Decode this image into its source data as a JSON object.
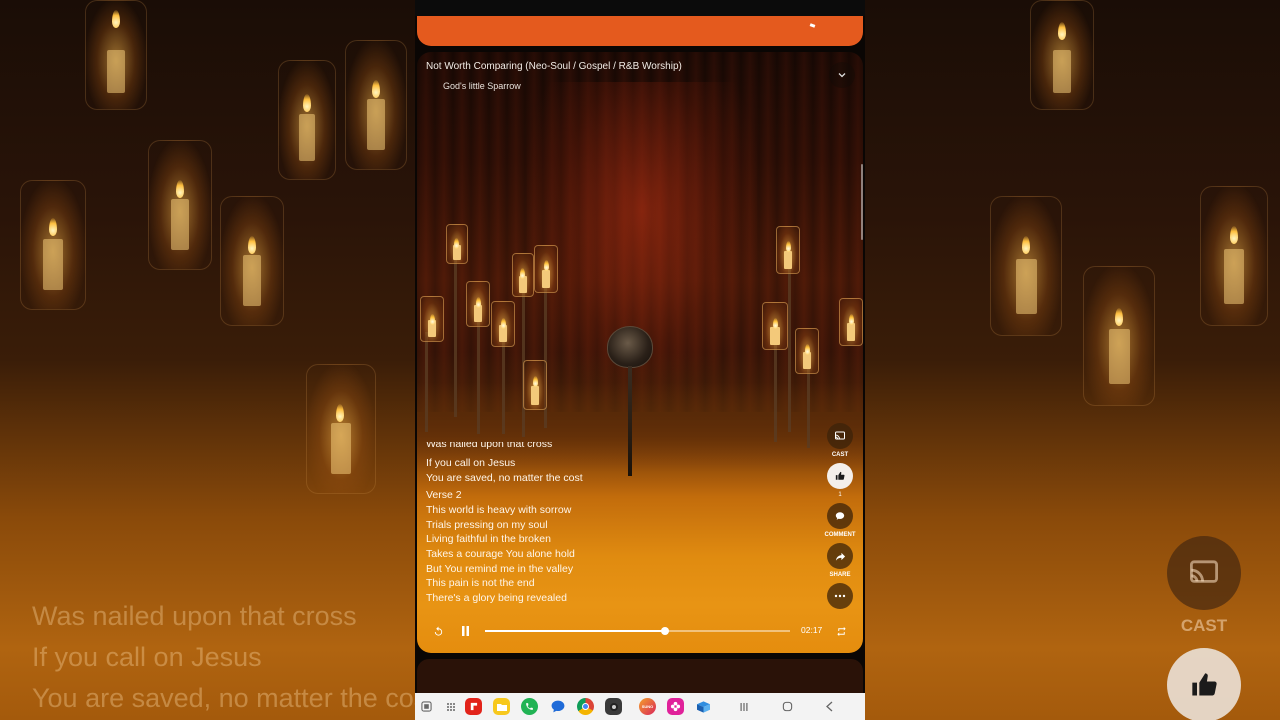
{
  "player": {
    "song_title": "Not Worth Comparing  (Neo-Soul / Gospel / R&B Worship)",
    "artist": "God's little Sparrow",
    "time": "02:17",
    "progress": 0.59
  },
  "lyrics": [
    "Was nailed upon that cross",
    "If you call on Jesus",
    "You are saved, no matter the cost",
    "Verse 2",
    "This world is heavy with sorrow",
    "Trials pressing on my soul",
    "Living faithful in the broken",
    "Takes a courage You alone hold",
    "But You remind me in the valley",
    "This pain is not the end",
    "There's a glory being revealed"
  ],
  "actions": {
    "cast_label": "CAST",
    "like_count": "1",
    "comment_label": "COMMENT",
    "share_label": "SHARE"
  },
  "background_lyrics": [
    "Was nailed upon that cross",
    "If you call on Jesus",
    "You are saved, no matter the cost"
  ],
  "background_cast_label": "CAST",
  "taskbar": {
    "apps": [
      "grid-icon",
      "flipboard-icon",
      "files-icon",
      "phone-icon",
      "messages-icon",
      "chrome-icon",
      "camera-icon",
      "suno-icon",
      "petal-icon",
      "box-icon"
    ],
    "suno_label": "SUNO"
  },
  "colors": {
    "accent_orange": "#e45a1e",
    "card_bottom": "#e58d0e"
  }
}
